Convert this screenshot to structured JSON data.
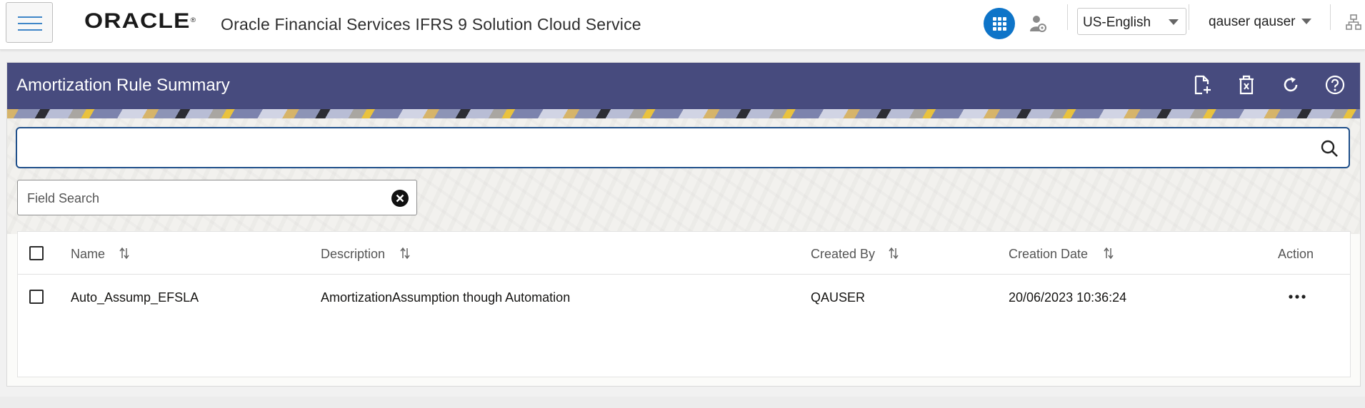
{
  "header": {
    "logo_text": "ORACLE",
    "logo_mark": "®",
    "product_title": "Oracle Financial Services IFRS 9 Solution Cloud Service",
    "language": "US-English",
    "user": "qauser qauser",
    "icons": {
      "menu": "hamburger-menu-icon",
      "apps": "app-grid-icon",
      "admin": "user-admin-icon",
      "hierarchy": "hierarchy-icon"
    },
    "accent_color": "#0e74c8"
  },
  "panel": {
    "title": "Amortization Rule Summary",
    "header_color": "#474b7e",
    "actions": [
      "add-document-icon",
      "delete-icon",
      "refresh-icon",
      "help-icon"
    ]
  },
  "search": {
    "value": "",
    "placeholder": ""
  },
  "field_search": {
    "value": "",
    "placeholder": "Field Search"
  },
  "table": {
    "columns": [
      "Name",
      "Description",
      "Created By",
      "Creation Date",
      "Action"
    ],
    "rows": [
      {
        "name": "Auto_Assump_EFSLA",
        "description": "AmortizationAssumption though Automation",
        "created_by": "QAUSER",
        "creation_date": "20/06/2023 10:36:24"
      }
    ]
  }
}
